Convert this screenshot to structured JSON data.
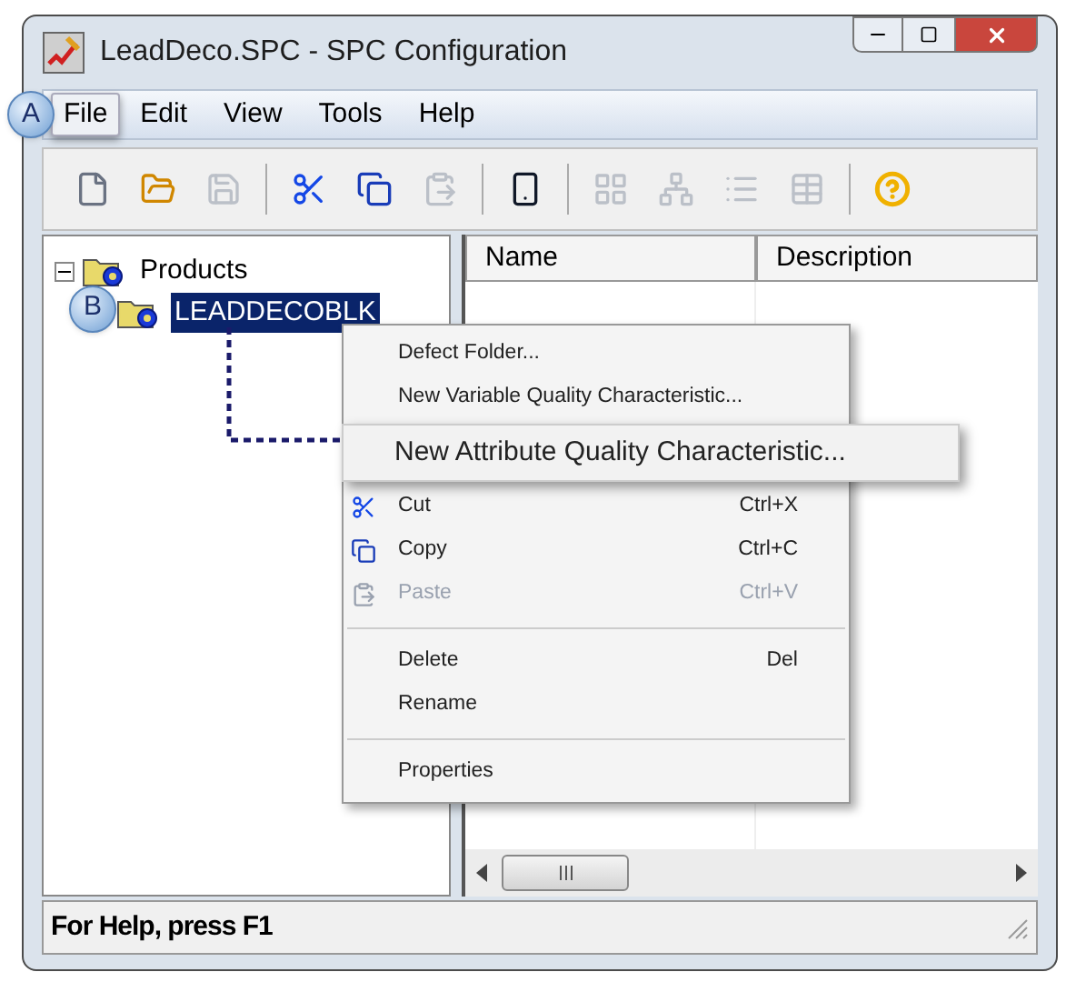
{
  "window": {
    "title": "LeadDeco.SPC - SPC Configuration"
  },
  "menu_bar": [
    {
      "label": "File",
      "selected": true
    },
    {
      "label": "Edit",
      "selected": false
    },
    {
      "label": "View",
      "selected": false
    },
    {
      "label": "Tools",
      "selected": false
    },
    {
      "label": "Help",
      "selected": false
    }
  ],
  "toolbar": [
    {
      "kind": "new",
      "disabled": false
    },
    {
      "kind": "open",
      "disabled": false
    },
    {
      "kind": "save",
      "disabled": true
    },
    {
      "kind": "separator"
    },
    {
      "kind": "cut",
      "disabled": false
    },
    {
      "kind": "copy",
      "disabled": false
    },
    {
      "kind": "paste",
      "disabled": true
    },
    {
      "kind": "separator"
    },
    {
      "kind": "device",
      "disabled": false
    },
    {
      "kind": "separator"
    },
    {
      "kind": "small-icons",
      "disabled": true
    },
    {
      "kind": "tree",
      "disabled": true
    },
    {
      "kind": "list",
      "disabled": true
    },
    {
      "kind": "details",
      "disabled": true
    },
    {
      "kind": "separator"
    },
    {
      "kind": "help",
      "disabled": false
    }
  ],
  "tree": [
    {
      "label": "Products",
      "expanded": true,
      "selected": false,
      "children": [
        {
          "label": "LEADDECOBLK",
          "selected": true
        }
      ]
    }
  ],
  "list": {
    "columns": [
      "Name",
      "Description"
    ]
  },
  "context_menu": [
    {
      "kind": "item",
      "label": "Defect Folder...",
      "disabled": false,
      "selected": false
    },
    {
      "kind": "item",
      "label": "New Variable Quality Characteristic...",
      "disabled": false,
      "selected": false
    },
    {
      "kind": "item",
      "label": "New Attribute Quality Characteristic...",
      "disabled": false,
      "selected": true
    },
    {
      "kind": "cut",
      "label": "Cut",
      "shortcut": "Ctrl+X",
      "disabled": false,
      "selected": false
    },
    {
      "kind": "copy",
      "label": "Copy",
      "shortcut": "Ctrl+C",
      "disabled": false,
      "selected": false
    },
    {
      "kind": "paste",
      "label": "Paste",
      "shortcut": "Ctrl+V",
      "disabled": true,
      "selected": false
    },
    {
      "kind": "separator"
    },
    {
      "kind": "item",
      "label": "Delete",
      "shortcut": "Del",
      "disabled": false,
      "selected": false
    },
    {
      "kind": "item",
      "label": "Rename",
      "disabled": false,
      "selected": false
    },
    {
      "kind": "separator"
    },
    {
      "kind": "item",
      "label": "Properties",
      "disabled": false,
      "selected": false
    }
  ],
  "callouts": [
    {
      "label": "A"
    },
    {
      "label": "B"
    }
  ],
  "status_bar": {
    "text": "For Help, press F1"
  }
}
